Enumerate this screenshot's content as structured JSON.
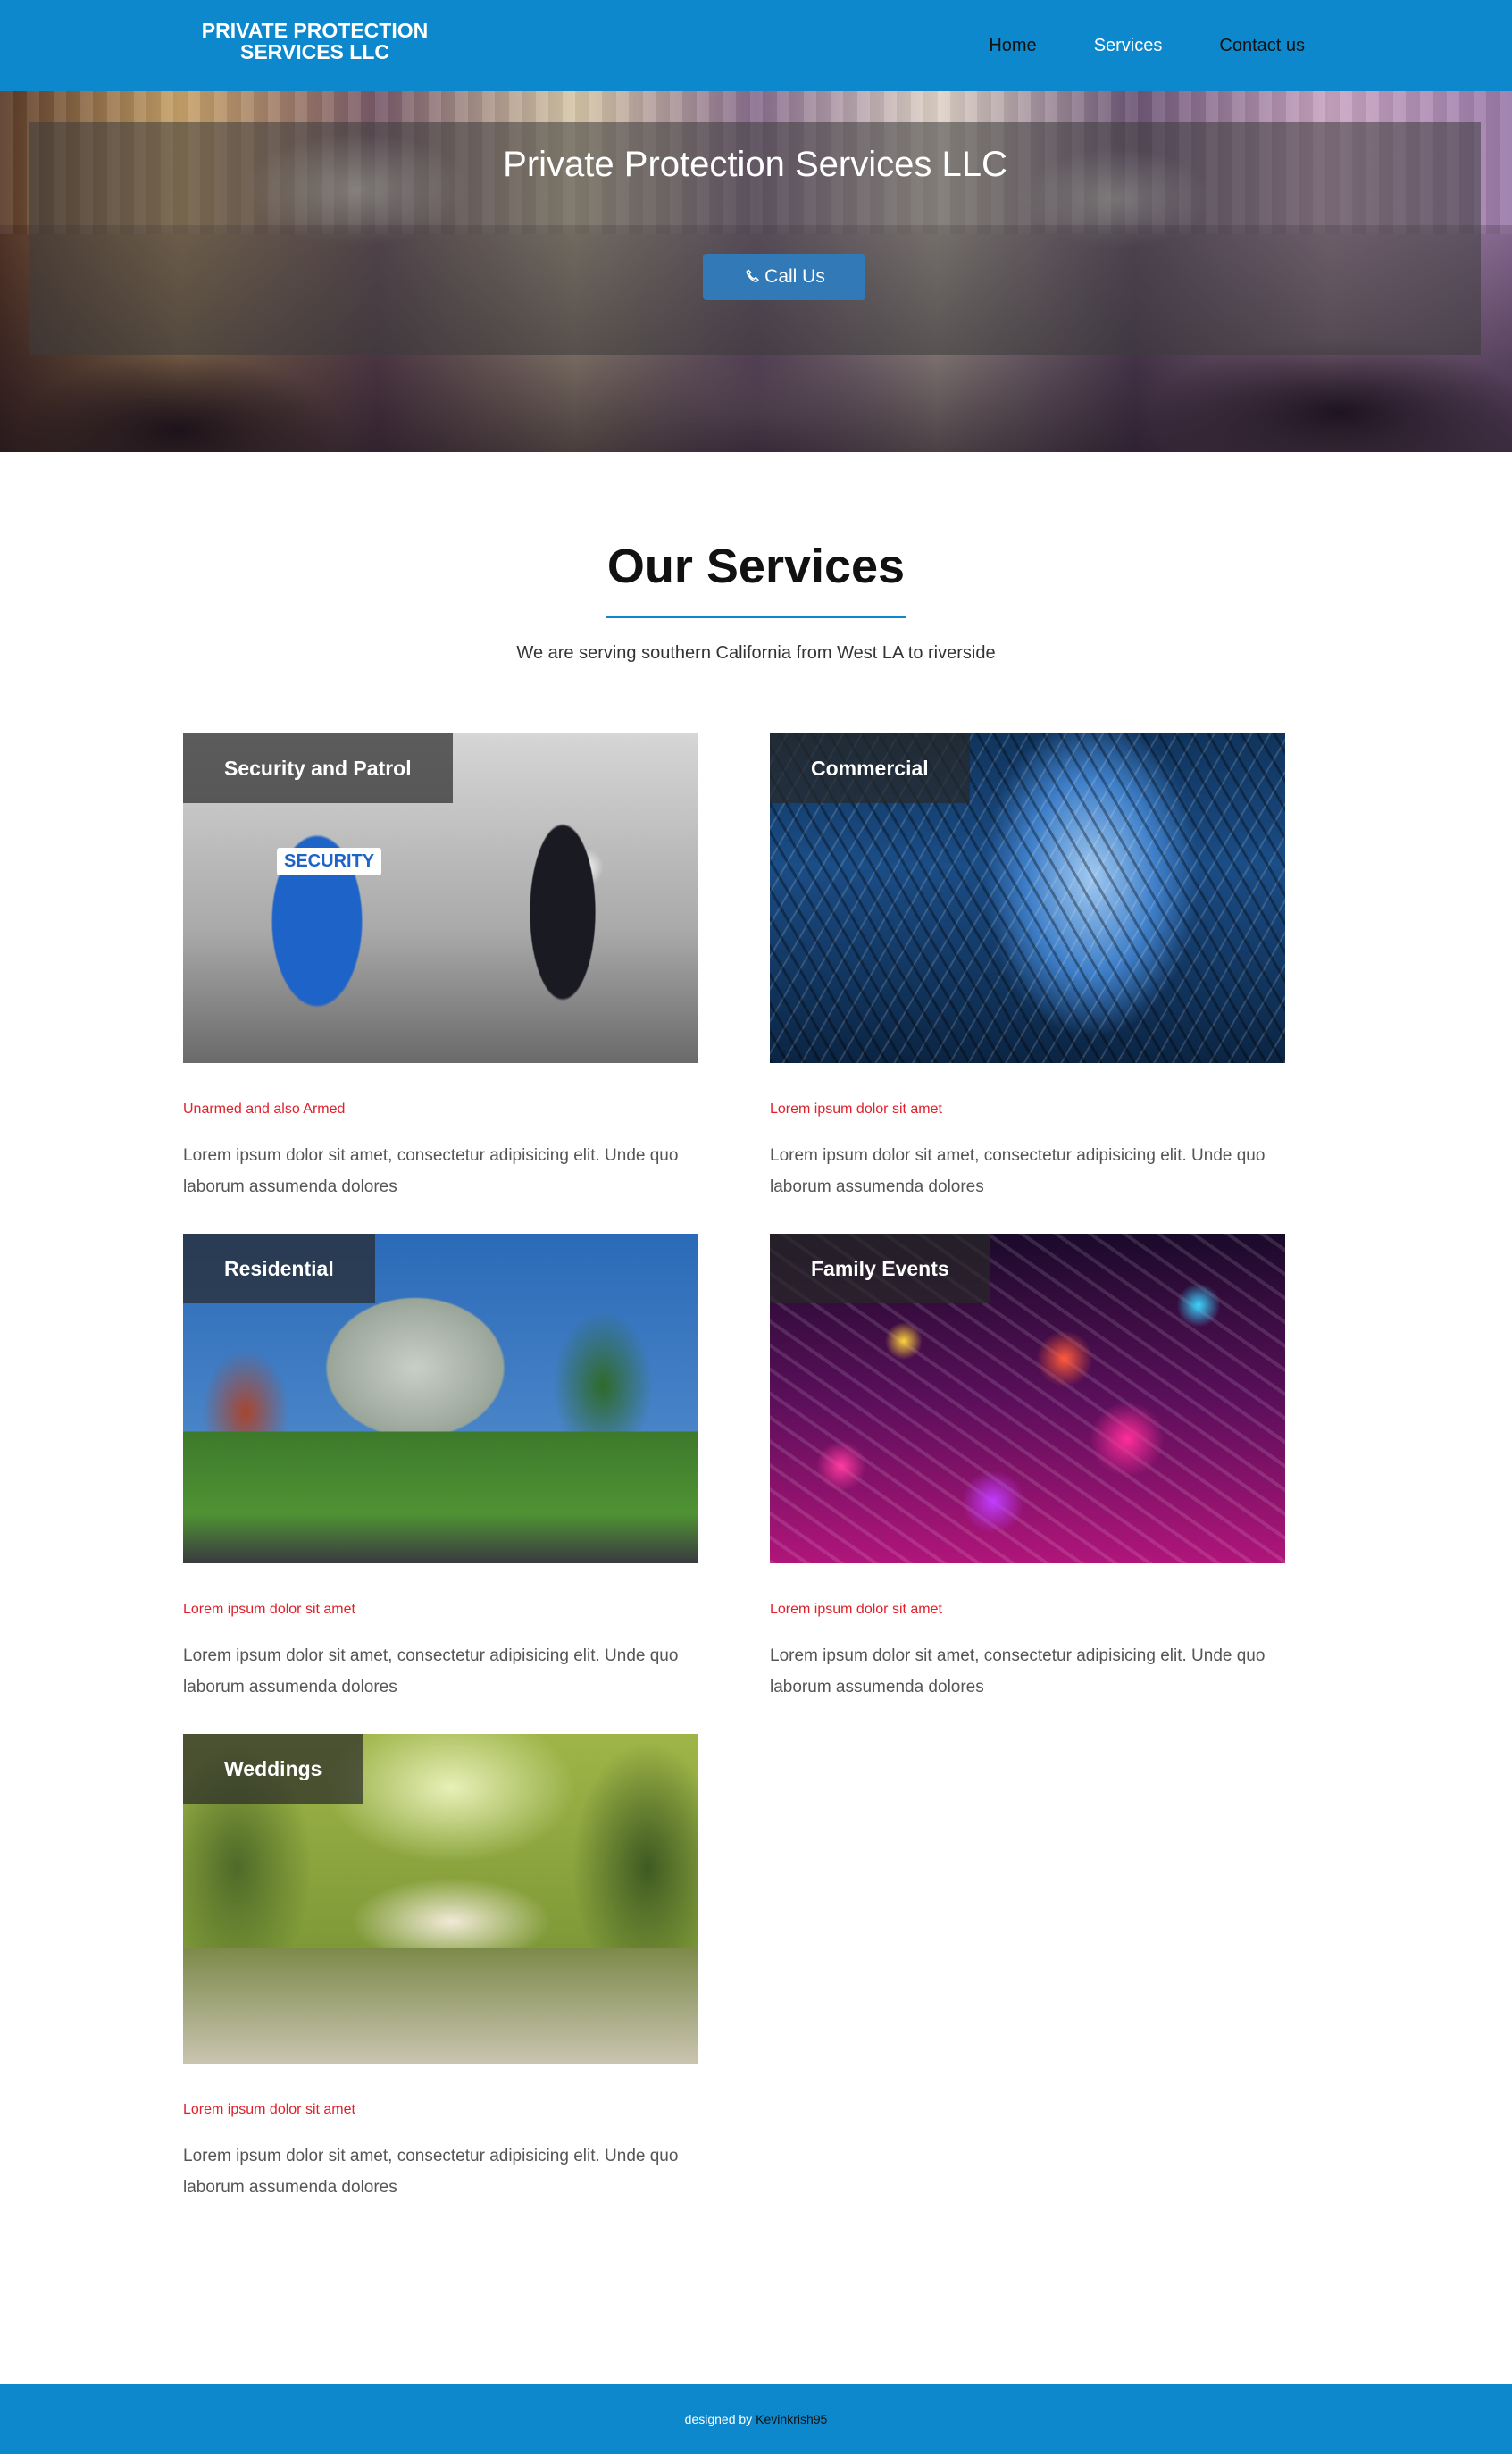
{
  "header": {
    "logo_text": "PRIVATE PROTECTION SERVICES LLC",
    "nav": [
      {
        "label": "Home",
        "active": false
      },
      {
        "label": "Services",
        "active": true
      },
      {
        "label": "Contact us",
        "active": false
      }
    ]
  },
  "hero": {
    "title": "Private Protection Services LLC",
    "call_button_label": "Call Us",
    "call_icon": "phone-icon"
  },
  "services": {
    "title": "Our Services",
    "subtitle": "We are serving southern California from West LA to riverside",
    "cards": [
      {
        "label": "Security and Patrol",
        "tag": "Unarmed and also Armed",
        "description": "Lorem ipsum dolor sit amet, consectetur adipisicing elit. Unde quo laborum assumenda dolores",
        "badge_text": "SECURITY"
      },
      {
        "label": "Commercial",
        "tag": "Lorem ipsum dolor sit amet",
        "description": "Lorem ipsum dolor sit amet, consectetur adipisicing elit. Unde quo laborum assumenda dolores"
      },
      {
        "label": "Residential",
        "tag": "Lorem ipsum dolor sit amet",
        "description": "Lorem ipsum dolor sit amet, consectetur adipisicing elit. Unde quo laborum assumenda dolores"
      },
      {
        "label": "Family Events",
        "tag": "Lorem ipsum dolor sit amet",
        "description": "Lorem ipsum dolor sit amet, consectetur adipisicing elit. Unde quo laborum assumenda dolores"
      },
      {
        "label": "Weddings",
        "tag": "Lorem ipsum dolor sit amet",
        "description": "Lorem ipsum dolor sit amet, consectetur adipisicing elit. Unde quo laborum assumenda dolores"
      }
    ]
  },
  "footer": {
    "prefix": "designed by",
    "author": "Kevinkrish95"
  },
  "colors": {
    "brand_blue": "#0d88cc",
    "button_blue": "#3279b8",
    "tag_red": "#e0202a"
  }
}
